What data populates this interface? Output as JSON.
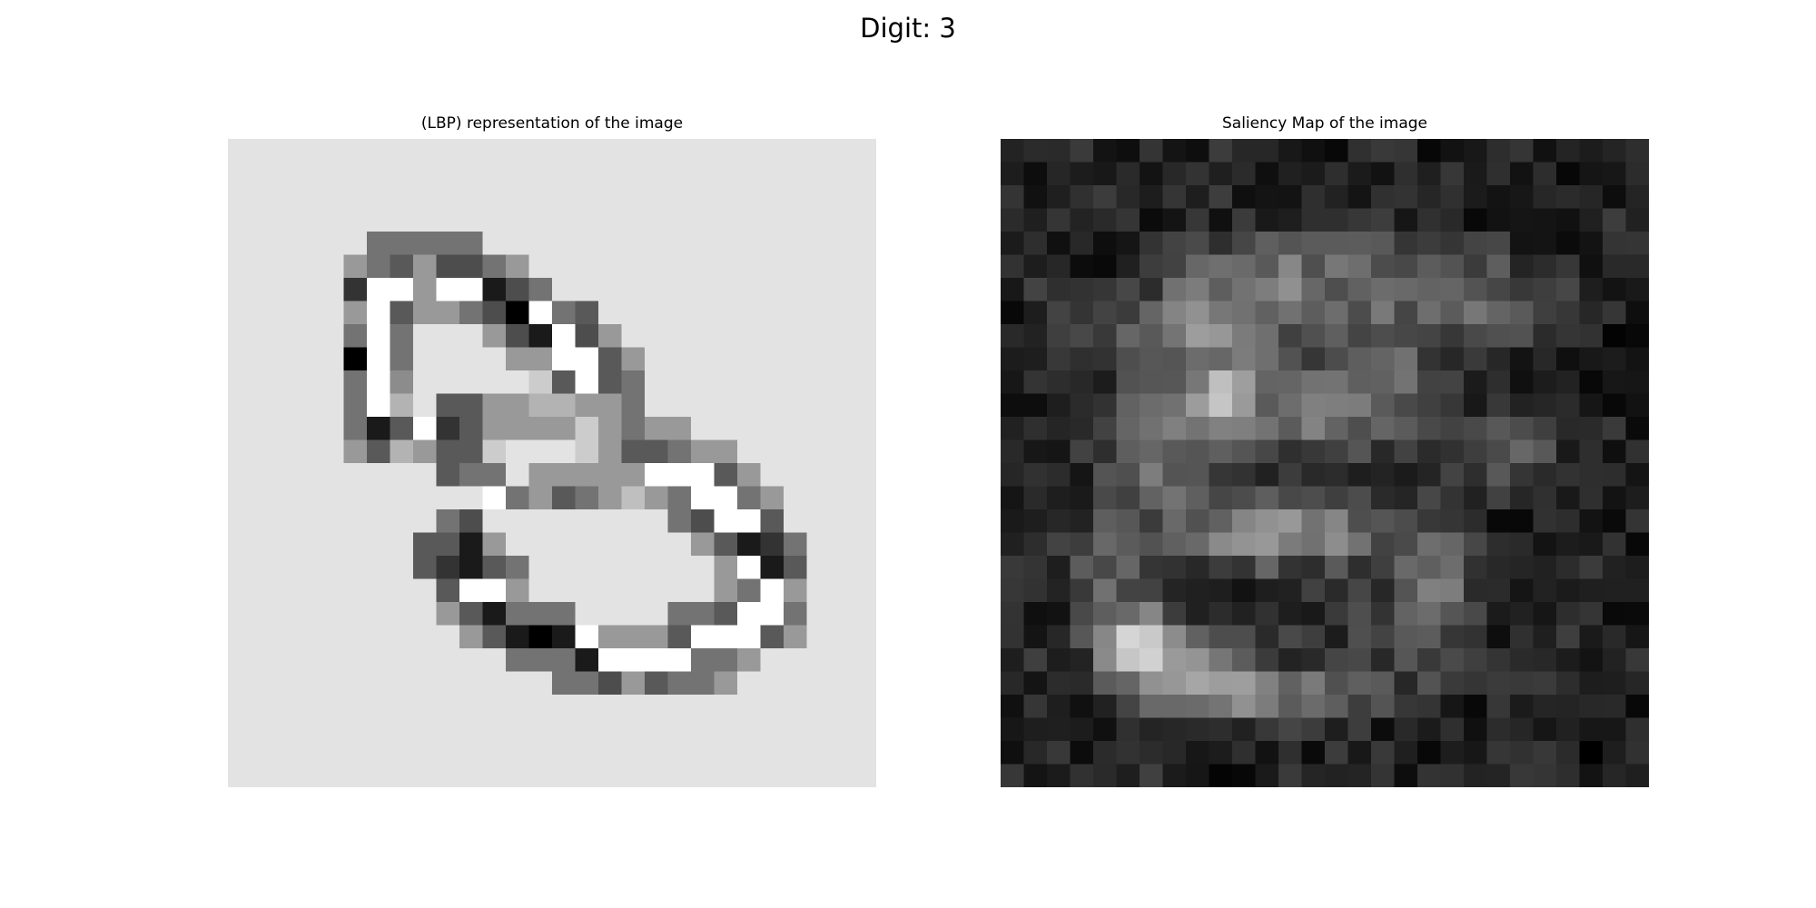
{
  "figure": {
    "suptitle": "Digit: 3"
  },
  "chart_data": [
    {
      "type": "heatmap",
      "title": "(LBP) representation of the image",
      "colormap": "gray",
      "shape": [
        28,
        28
      ],
      "background_level": 0.89,
      "grid": false,
      "axes_visible": false,
      "rows": [
        {
          "r": 4,
          "c0": 6,
          "v": [
            0.45,
            0.45,
            0.45,
            0.45,
            0.45
          ]
        },
        {
          "r": 5,
          "c0": 5,
          "v": [
            0.6,
            0.45,
            0.35,
            0.6,
            0.3,
            0.3,
            0.45,
            0.6
          ]
        },
        {
          "r": 6,
          "c0": 5,
          "v": [
            0.2,
            1,
            1,
            0.6,
            1,
            1,
            0.1,
            0.3,
            0.45
          ]
        },
        {
          "r": 7,
          "c0": 5,
          "v": [
            0.6,
            1,
            0.35,
            0.6,
            0.6,
            0.45,
            0.3,
            0,
            1,
            0.45,
            0.35
          ]
        },
        {
          "r": 8,
          "c0": 5,
          "v": [
            0.45,
            1,
            0.45,
            0.89,
            0.89,
            0.89,
            0.6,
            0.3,
            0.1,
            1,
            0.3,
            0.6
          ]
        },
        {
          "r": 9,
          "c0": 5,
          "v": [
            0,
            1,
            0.45,
            0.89,
            0.89,
            0.89,
            0.89,
            0.6,
            0.6,
            1,
            1,
            0.35,
            0.6
          ]
        },
        {
          "r": 10,
          "c0": 5,
          "v": [
            0.45,
            1,
            0.55,
            0.89,
            0.89,
            0.89,
            0.89,
            0.89,
            0.8,
            0.35,
            1,
            0.35,
            0.45
          ]
        },
        {
          "r": 11,
          "c0": 5,
          "v": [
            0.45,
            1,
            0.7,
            0.89,
            0.35,
            0.35,
            0.6,
            0.6,
            0.7,
            0.7,
            0.6,
            0.6,
            0.45
          ]
        },
        {
          "r": 12,
          "c0": 5,
          "v": [
            0.45,
            0.1,
            0.35,
            1,
            0.2,
            0.35,
            0.6,
            0.6,
            0.6,
            0.6,
            0.8,
            0.6,
            0.45,
            0.6,
            0.6
          ]
        },
        {
          "r": 13,
          "c0": 5,
          "v": [
            0.6,
            0.35,
            0.7,
            0.6,
            0.35,
            0.35,
            0.8,
            0.89,
            0.89,
            0.89,
            0.8,
            0.6,
            0.35,
            0.35,
            0.45,
            0.6,
            0.6
          ]
        },
        {
          "r": 14,
          "c0": 9,
          "v": [
            0.35,
            0.45,
            0.45,
            0.89,
            0.6,
            0.6,
            0.6,
            0.6,
            0.6,
            1,
            1,
            1,
            0.35,
            0.6
          ]
        },
        {
          "r": 15,
          "c0": 11,
          "v": [
            1,
            0.45,
            0.6,
            0.35,
            0.45,
            0.6,
            0.75,
            0.6,
            0.45,
            1,
            1,
            0.45,
            0.6
          ]
        },
        {
          "r": 16,
          "c0": 9,
          "v": [
            0.45,
            0.3,
            0.89,
            0.89,
            0.89,
            0.89,
            0.89,
            0.89,
            0.89,
            0.89,
            0.45,
            0.3,
            1,
            1,
            0.35
          ]
        },
        {
          "r": 17,
          "c0": 8,
          "v": [
            0.35,
            0.35,
            0.1,
            0.6,
            0.89,
            0.89,
            0.89,
            0.89,
            0.89,
            0.89,
            0.89,
            0.89,
            0.6,
            0.35,
            0.1,
            0.2,
            0.45
          ]
        },
        {
          "r": 18,
          "c0": 8,
          "v": [
            0.35,
            0.2,
            0.1,
            0.35,
            0.45,
            0.89,
            0.89,
            0.89,
            0.89,
            0.89,
            0.89,
            0.89,
            0.89,
            0.6,
            1,
            0.1,
            0.35
          ]
        },
        {
          "r": 19,
          "c0": 9,
          "v": [
            0.35,
            1,
            1,
            0.6,
            0.89,
            0.89,
            0.89,
            0.89,
            0.89,
            0.89,
            0.89,
            0.89,
            0.6,
            0.45,
            1,
            0.6
          ]
        },
        {
          "r": 20,
          "c0": 9,
          "v": [
            0.6,
            0.35,
            0.1,
            0.45,
            0.45,
            0.45,
            0.89,
            0.89,
            0.89,
            0.89,
            0.45,
            0.45,
            0.35,
            1,
            1,
            0.45
          ]
        },
        {
          "r": 21,
          "c0": 10,
          "v": [
            0.6,
            0.35,
            0.1,
            0,
            0.1,
            1,
            0.6,
            0.6,
            0.6,
            0.35,
            1,
            1,
            1,
            0.35,
            0.6
          ]
        },
        {
          "r": 22,
          "c0": 12,
          "v": [
            0.45,
            0.45,
            0.45,
            0.1,
            1,
            1,
            1,
            1,
            0.45,
            0.45,
            0.6
          ]
        },
        {
          "r": 23,
          "c0": 14,
          "v": [
            0.45,
            0.45,
            0.3,
            0.6,
            0.35,
            0.45,
            0.45,
            0.6
          ]
        }
      ]
    },
    {
      "type": "heatmap",
      "title": "Saliency Map of the image",
      "colormap": "gray",
      "shape": [
        28,
        28
      ],
      "grid": false,
      "axes_visible": false,
      "seed": 7,
      "noise_level": 0.13,
      "noise_spread": 0.1,
      "blobs": [
        {
          "row": 5.5,
          "col": 12,
          "sigma_r": 1.3,
          "sigma_c": 3.5,
          "amp": 0.32
        },
        {
          "row": 7.5,
          "col": 8.5,
          "sigma_r": 0.9,
          "sigma_c": 3.0,
          "amp": 0.33
        },
        {
          "row": 6.5,
          "col": 19.5,
          "sigma_r": 1.5,
          "sigma_c": 2.5,
          "amp": 0.25
        },
        {
          "row": 10.5,
          "col": 9.5,
          "sigma_r": 1.0,
          "sigma_c": 0.9,
          "amp": 0.45
        },
        {
          "row": 11.0,
          "col": 8.0,
          "sigma_r": 2.0,
          "sigma_c": 2.5,
          "amp": 0.28
        },
        {
          "row": 11.5,
          "col": 13.5,
          "sigma_r": 1.5,
          "sigma_c": 1.5,
          "amp": 0.28
        },
        {
          "row": 10.0,
          "col": 16.0,
          "sigma_r": 1.5,
          "sigma_c": 1.5,
          "amp": 0.3
        },
        {
          "row": 13.5,
          "col": 6.0,
          "sigma_r": 1.5,
          "sigma_c": 1.5,
          "amp": 0.22
        },
        {
          "row": 13.0,
          "col": 21.5,
          "sigma_r": 1.2,
          "sigma_c": 1.5,
          "amp": 0.2
        },
        {
          "row": 16.5,
          "col": 11.5,
          "sigma_r": 1.0,
          "sigma_c": 3.0,
          "amp": 0.5
        },
        {
          "row": 18.5,
          "col": 4.0,
          "sigma_r": 2.0,
          "sigma_c": 1.2,
          "amp": 0.25
        },
        {
          "row": 18.5,
          "col": 18.5,
          "sigma_r": 2.0,
          "sigma_c": 1.0,
          "amp": 0.35
        },
        {
          "row": 21.5,
          "col": 5.5,
          "sigma_r": 1.2,
          "sigma_c": 1.2,
          "amp": 0.62
        },
        {
          "row": 22.5,
          "col": 8.5,
          "sigma_r": 1.2,
          "sigma_c": 1.8,
          "amp": 0.35
        },
        {
          "row": 23.5,
          "col": 11.5,
          "sigma_r": 0.8,
          "sigma_c": 3.5,
          "amp": 0.32
        },
        {
          "row": 20.5,
          "col": 16.0,
          "sigma_r": 1.5,
          "sigma_c": 1.5,
          "amp": 0.15
        }
      ]
    }
  ]
}
